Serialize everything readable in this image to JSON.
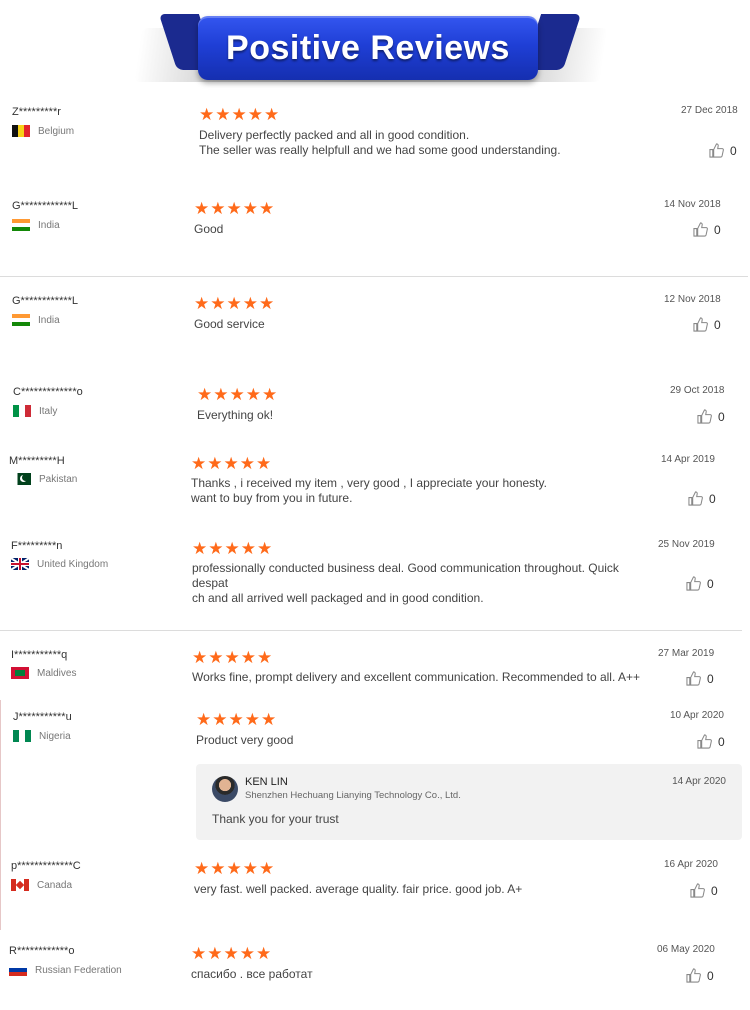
{
  "banner": {
    "title": "Positive Reviews"
  },
  "colors": {
    "star": "#ff6a1a",
    "banner": "#1f3fd6"
  },
  "reviews": [
    {
      "name": "Z*********r",
      "country": "Belgium",
      "flag": "belgium",
      "stars": "★★★★★",
      "text": "Delivery perfectly packed and all in good condition.\nThe seller was really helpfull and we had some good understanding.",
      "date": "27 Dec 2018",
      "likes": "0"
    },
    {
      "name": "G************L",
      "country": "India",
      "flag": "india",
      "stars": "★★★★★",
      "text": "Good",
      "date": "14 Nov 2018",
      "likes": "0"
    },
    {
      "name": "G************L",
      "country": "India",
      "flag": "india",
      "stars": "★★★★★",
      "text": "Good service",
      "date": "12 Nov 2018",
      "likes": "0"
    },
    {
      "name": "C*************o",
      "country": "Italy",
      "flag": "italy",
      "stars": "★★★★★",
      "text": "Everything ok!",
      "date": "29 Oct 2018",
      "likes": "0"
    },
    {
      "name": "M*********H",
      "country": "Pakistan",
      "flag": "pakistan",
      "stars": "★★★★★",
      "text": "Thanks , i received my item , very good , I appreciate your honesty.\nwant to buy from you in future.",
      "date": "14 Apr 2019",
      "likes": "0"
    },
    {
      "name": "F*********n",
      "country": "United Kingdom",
      "flag": "uk",
      "stars": "★★★★★",
      "text": "professionally conducted business deal. Good communication throughout. Quick despat\nch and all arrived well packaged and in good condition.",
      "date": "25 Nov 2019",
      "likes": "0"
    },
    {
      "name": "I***********q",
      "country": "Maldives",
      "flag": "maldives",
      "stars": "★★★★★",
      "text": "Works fine, prompt delivery and excellent communication. Recommended to all. A++",
      "date": "27 Mar 2019",
      "likes": "0"
    },
    {
      "name": "J***********u",
      "country": "Nigeria",
      "flag": "nigeria",
      "stars": "★★★★★",
      "text": "Product very good",
      "date": "10 Apr 2020",
      "likes": "0"
    },
    {
      "name": "p*************C",
      "country": "Canada",
      "flag": "canada",
      "stars": "★★★★★",
      "text": "very fast. well packed. average quality. fair price. good job. A+",
      "date": "16 Apr 2020",
      "likes": "0"
    },
    {
      "name": "R************o",
      "country": "Russian Federation",
      "flag": "russia",
      "stars": "★★★★★",
      "text": "спасибо . все работат",
      "date": "06 May 2020",
      "likes": "0"
    }
  ],
  "reply": {
    "seller_name": "KEN LIN",
    "company": "Shenzhen Hechuang Lianying Technology Co., Ltd.",
    "date": "14 Apr 2020",
    "text": "Thank you for your trust"
  }
}
